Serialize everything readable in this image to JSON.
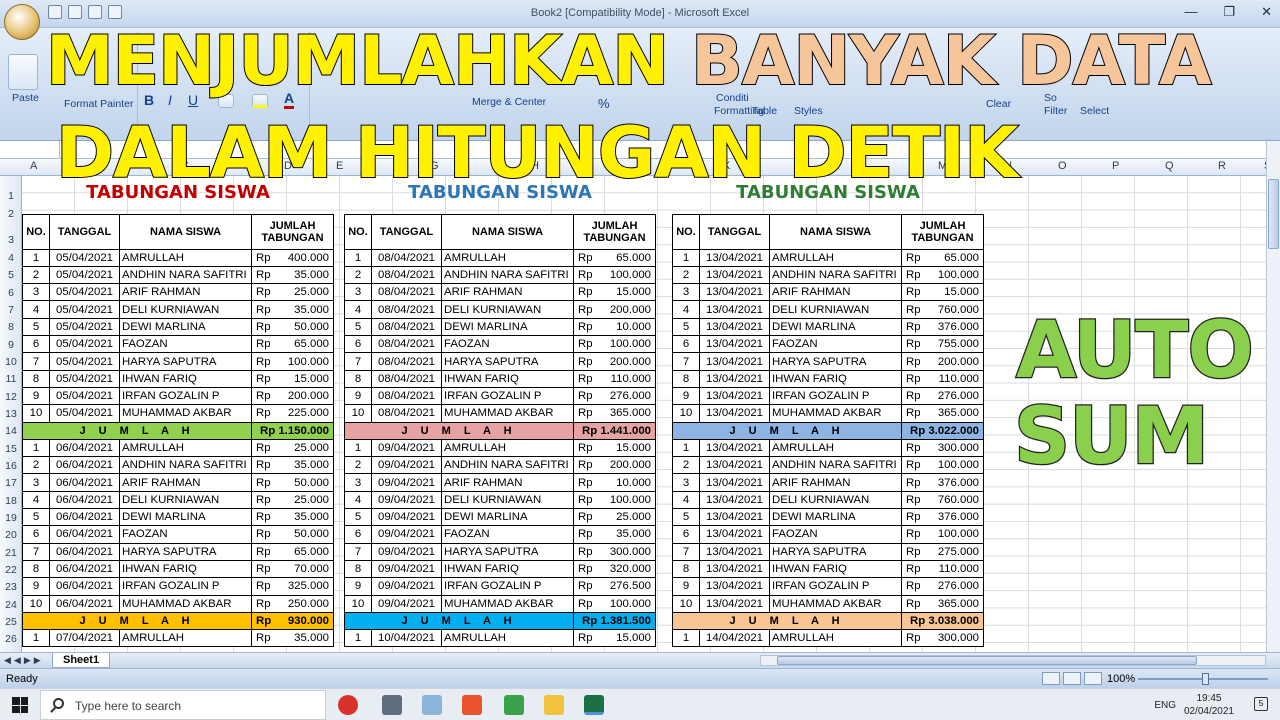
{
  "window": {
    "title": "Book2 [Compatibility Mode] - Microsoft Excel"
  },
  "overlay": {
    "line1_a": "MENJUMLAHKAN",
    "line1_b": "BANYAK DATA",
    "line2": "DALAM HITUNGAN DETIK",
    "side1": "AUTO",
    "side2": "SUM"
  },
  "ribbon": {
    "paste": "Paste",
    "format_painter": "Format Painter",
    "merge_center": "Merge & Center",
    "conditional_formatting_a": "Conditi",
    "conditional_formatting_b": "Formatting",
    "format_as_table": "Table",
    "cell_styles": "Styles",
    "clear": "Clear",
    "sort_filter_a": "So",
    "sort_filter_b": "Filter",
    "find_select": "Select"
  },
  "colors": {
    "title1": "#c00000",
    "title2": "#2e75b6",
    "title3": "#2e7d32",
    "sum_green": "#92d050",
    "sum_pink": "#e6a3a3",
    "sum_blue": "#8eb4e3",
    "sum_gold": "#ffc000",
    "sum_cyan": "#00b0f0",
    "sum_peach": "#f8c594"
  },
  "columns": [
    "A",
    "B",
    "C",
    "D",
    "E",
    "F",
    "G",
    "H",
    "I",
    "J",
    "K",
    "L",
    "M",
    "N",
    "O",
    "P",
    "Q",
    "R",
    "S"
  ],
  "rows": [
    "1",
    "2",
    "3",
    "4",
    "5",
    "6",
    "7",
    "8",
    "9",
    "10",
    "11",
    "12",
    "13",
    "14",
    "15",
    "16",
    "17",
    "18",
    "19",
    "20",
    "21",
    "22",
    "23",
    "24",
    "25",
    "26"
  ],
  "headers": {
    "no": "NO.",
    "tanggal": "TANGGAL",
    "nama": "NAMA SISWA",
    "jumlah1": "JUMLAH",
    "jumlah2": "TABUNGAN"
  },
  "blocks": [
    {
      "title": "TABUNGAN SISWA",
      "sections": [
        {
          "date": "05/04/2021",
          "amounts": [
            "400.000",
            "35.000",
            "25.000",
            "35.000",
            "50.000",
            "65.000",
            "100.000",
            "15.000",
            "200.000",
            "225.000"
          ],
          "total": "Rp 1.150.000"
        },
        {
          "date": "06/04/2021",
          "amounts": [
            "25.000",
            "35.000",
            "50.000",
            "25.000",
            "35.000",
            "50.000",
            "65.000",
            "70.000",
            "325.000",
            "250.000"
          ],
          "total": "930.000",
          "total_split": true
        }
      ],
      "last": {
        "date": "07/04/2021",
        "amount": "35.000"
      }
    },
    {
      "title": "TABUNGAN SISWA",
      "sections": [
        {
          "date": "08/04/2021",
          "amounts": [
            "65.000",
            "100.000",
            "15.000",
            "200.000",
            "10.000",
            "100.000",
            "200.000",
            "110.000",
            "276.000",
            "365.000"
          ],
          "total": "Rp 1.441.000"
        },
        {
          "date": "09/04/2021",
          "amounts": [
            "15.000",
            "200.000",
            "10.000",
            "100.000",
            "25.000",
            "35.000",
            "300.000",
            "320.000",
            "276.500",
            "100.000"
          ],
          "total": "Rp 1.381.500"
        }
      ],
      "last": {
        "date": "10/04/2021",
        "amount": "15.000"
      }
    },
    {
      "title": "TABUNGAN SISWA",
      "sections": [
        {
          "date": "13/04/2021",
          "amounts": [
            "65.000",
            "100.000",
            "15.000",
            "760.000",
            "376.000",
            "755.000",
            "200.000",
            "110.000",
            "276.000",
            "365.000"
          ],
          "total": "Rp 3.022.000"
        },
        {
          "date": "13/04/2021",
          "amounts": [
            "300.000",
            "100.000",
            "376.000",
            "760.000",
            "376.000",
            "100.000",
            "275.000",
            "110.000",
            "276.000",
            "365.000"
          ],
          "total": "Rp 3.038.000"
        }
      ],
      "last": {
        "date": "14/04/2021",
        "amount": "300.000"
      }
    }
  ],
  "names": [
    "AMRULLAH",
    "ANDHIN NARA SAFITRI",
    "ARIF RAHMAN",
    "DELI KURNIAWAN",
    "DEWI MARLINA",
    "FAOZAN",
    "HARYA SAPUTRA",
    "IHWAN FARIQ",
    "IRFAN GOZALIN P",
    "MUHAMMAD AKBAR"
  ],
  "sum_label": "J U M L A H",
  "currency": "Rp",
  "sheet": {
    "tab": "Sheet1"
  },
  "status": {
    "ready": "Ready",
    "zoom": "100%"
  },
  "taskbar": {
    "search_placeholder": "Type here to search",
    "lang": "ENG",
    "time": "19:45",
    "date": "02/04/2021",
    "notifications": "5"
  }
}
